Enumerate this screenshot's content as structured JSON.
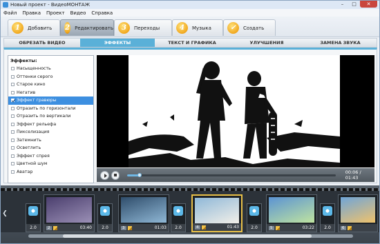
{
  "window": {
    "title": "Новый проект - ВидеоМОНТАЖ",
    "minimize": "–",
    "maximize": "□",
    "close": "✕"
  },
  "menu": [
    "Файл",
    "Правка",
    "Проект",
    "Видео",
    "Справка"
  ],
  "steps": [
    {
      "num": "1",
      "label": "Добавить",
      "active": false
    },
    {
      "num": "2",
      "label": "Редактировать",
      "active": true
    },
    {
      "num": "3",
      "label": "Переходы",
      "active": false
    },
    {
      "num": "4",
      "label": "Музыка",
      "active": false
    },
    {
      "num": "✓",
      "label": "Создать",
      "active": false
    }
  ],
  "tabs": [
    {
      "label": "ОБРЕЗАТЬ ВИДЕО",
      "active": false
    },
    {
      "label": "ЭФФЕКТЫ",
      "active": true
    },
    {
      "label": "ТЕКСТ И ГРАФИКА",
      "active": false
    },
    {
      "label": "УЛУЧШЕНИЯ",
      "active": false
    },
    {
      "label": "ЗАМЕНА ЗВУКА",
      "active": false
    }
  ],
  "effects": {
    "title": "Эффекты:",
    "items": [
      {
        "label": "Насыщенность",
        "checked": false
      },
      {
        "label": "Оттенки серого",
        "checked": false
      },
      {
        "label": "Старое кино",
        "checked": false
      },
      {
        "label": "Негатив",
        "checked": false
      },
      {
        "label": "Эффект гравюры",
        "checked": true
      },
      {
        "label": "Отразить по горизонтали",
        "checked": false
      },
      {
        "label": "Отразить по вертикали",
        "checked": false
      },
      {
        "label": "Эффект рельефа",
        "checked": false
      },
      {
        "label": "Пикселизация",
        "checked": false
      },
      {
        "label": "Затемнить",
        "checked": false
      },
      {
        "label": "Осветлить",
        "checked": false
      },
      {
        "label": "Эффект спрея",
        "checked": false
      },
      {
        "label": "Цветной шум",
        "checked": false
      },
      {
        "label": "Аватар",
        "checked": false
      }
    ]
  },
  "player": {
    "time": "00:06 / 01:43",
    "progress": 0.06
  },
  "timeline": {
    "clips": [
      {
        "num": "2",
        "duration": "03:40",
        "active": false,
        "colors": [
          "#4b3f6e",
          "#9a8fb5"
        ]
      },
      {
        "num": "3",
        "duration": "01:03",
        "active": false,
        "colors": [
          "#2f4d6b",
          "#8fb7d5"
        ]
      },
      {
        "num": "4",
        "duration": "01:43",
        "active": true,
        "colors": [
          "#8fb8d8",
          "#f2efe8"
        ]
      },
      {
        "num": "5",
        "duration": "03:22",
        "active": false,
        "colors": [
          "#5b93d3",
          "#bfe3a0"
        ]
      },
      {
        "num": "6",
        "duration": "",
        "active": false,
        "colors": [
          "#6fa5d9",
          "#f0c26b"
        ]
      }
    ],
    "transitions": [
      "2.0",
      "2.0",
      "2.0",
      "2.0",
      "2.0"
    ]
  }
}
